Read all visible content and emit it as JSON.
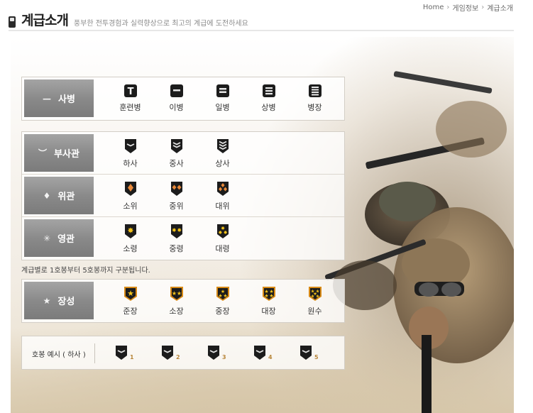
{
  "breadcrumb": [
    "Home",
    "게임정보",
    "계급소개"
  ],
  "header": {
    "title": "계급소개",
    "subtitle": "풍부한 전투경험과 실력향상으로 최고의 계급에 도전하세요"
  },
  "groups": [
    {
      "rows": [
        {
          "category": "사병",
          "symbol": "—",
          "ranks": [
            {
              "label": "훈련병",
              "icon": "trainee-icon",
              "stripes": 0
            },
            {
              "label": "이병",
              "icon": "private-icon",
              "stripes": 1
            },
            {
              "label": "일병",
              "icon": "private-first-class-icon",
              "stripes": 2
            },
            {
              "label": "상병",
              "icon": "corporal-icon",
              "stripes": 3
            },
            {
              "label": "병장",
              "icon": "sergeant-icon",
              "stripes": 4
            }
          ]
        }
      ]
    },
    {
      "rows": [
        {
          "category": "부사관",
          "symbol": "︶",
          "ranks": [
            {
              "label": "하사",
              "icon": "staff-sergeant-icon",
              "chevrons": 1
            },
            {
              "label": "중사",
              "icon": "sergeant-first-class-icon",
              "chevrons": 2
            },
            {
              "label": "상사",
              "icon": "master-sergeant-icon",
              "chevrons": 3
            }
          ]
        },
        {
          "category": "위관",
          "symbol": "♦",
          "ranks": [
            {
              "label": "소위",
              "icon": "second-lieutenant-icon",
              "diamonds": 1
            },
            {
              "label": "중위",
              "icon": "first-lieutenant-icon",
              "diamonds": 2
            },
            {
              "label": "대위",
              "icon": "captain-icon",
              "diamonds": 3
            }
          ]
        },
        {
          "category": "영관",
          "symbol": "✳",
          "ranks": [
            {
              "label": "소령",
              "icon": "major-icon",
              "suns": 1
            },
            {
              "label": "중령",
              "icon": "lieutenant-colonel-icon",
              "suns": 2
            },
            {
              "label": "대령",
              "icon": "colonel-icon",
              "suns": 3
            }
          ]
        }
      ]
    },
    {
      "rows": [
        {
          "category": "장성",
          "symbol": "★",
          "ranks": [
            {
              "label": "준장",
              "icon": "brigadier-general-icon",
              "stars": 1
            },
            {
              "label": "소장",
              "icon": "major-general-icon",
              "stars": 2
            },
            {
              "label": "중장",
              "icon": "lieutenant-general-icon",
              "stars": 3
            },
            {
              "label": "대장",
              "icon": "general-icon",
              "stars": 4
            },
            {
              "label": "원수",
              "icon": "marshal-icon",
              "stars": 5
            }
          ]
        }
      ]
    }
  ],
  "note": "계급별로 1호봉부터 5호봉까지 구분됩니다.",
  "example": {
    "label": "호봉 예시 ( 하사 )",
    "steps": [
      "1",
      "2",
      "3",
      "4",
      "5"
    ]
  },
  "colors": {
    "badge_dark": "#1c1c1c",
    "badge_orange": "#d88a16",
    "badge_gold": "#f2c21a",
    "category_gray": "#8c8c8c"
  }
}
